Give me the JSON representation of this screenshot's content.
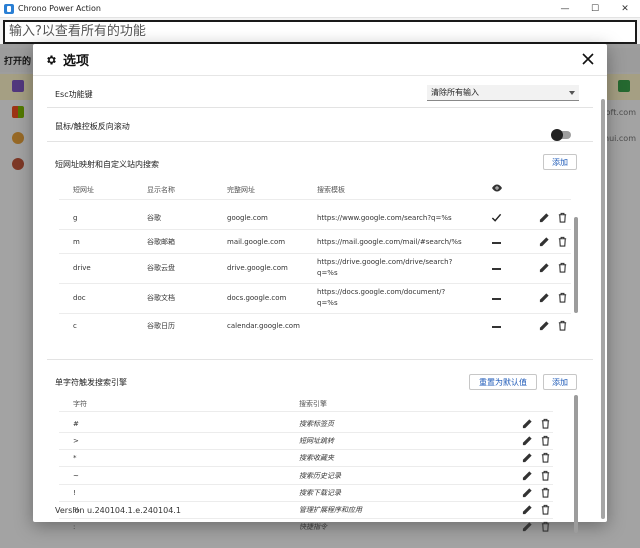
{
  "window": {
    "title": "Chrono Power Action",
    "controls": [
      "—",
      "☐",
      "✕"
    ]
  },
  "background": {
    "search_placeholder": "输入?以查看所有的功能",
    "open_label": "打开的",
    "row_hints": [
      "soft.com",
      "zhui.com"
    ]
  },
  "dialog": {
    "title": "选项",
    "esc": {
      "label": "Esc功能键",
      "selected": "清除所有输入"
    },
    "reverse_scroll": {
      "label": "鼠标/触控板反向滚动",
      "enabled": false
    },
    "shortcuts": {
      "section_title": "短网址映射和自定义站内搜索",
      "add_label": "添加",
      "headers": [
        "短网址",
        "显示名称",
        "完整网址",
        "搜索模板"
      ],
      "rows": [
        {
          "short": "g",
          "name": "谷歌",
          "url": "google.com",
          "template": "https://www.google.com/search?q=%s",
          "visible": true
        },
        {
          "short": "m",
          "name": "谷歌邮箱",
          "url": "mail.google.com",
          "template": "https://mail.google.com/mail/#search/%s",
          "visible": false
        },
        {
          "short": "drive",
          "name": "谷歌云盘",
          "url": "drive.google.com",
          "template": "https://drive.google.com/drive/search?q=%s",
          "template_line1": "https://drive.google.com/drive/search?",
          "template_line2": "q=%s",
          "visible": false
        },
        {
          "short": "doc",
          "name": "谷歌文档",
          "url": "docs.google.com",
          "template": "https://docs.google.com/document/?q=%s",
          "template_line1": "https://docs.google.com/document/?",
          "template_line2": "q=%s",
          "visible": false
        },
        {
          "short": "c",
          "name": "谷歌日历",
          "url": "calendar.google.com",
          "template": "",
          "visible": false
        }
      ]
    },
    "triggers": {
      "section_title": "单字符触发搜索引擎",
      "reset_label": "重置为默认值",
      "add_label": "添加",
      "headers": [
        "字符",
        "搜索引擎"
      ],
      "rows": [
        {
          "char": "#",
          "engine": "搜索标签页"
        },
        {
          "char": ">",
          "engine": "短网址跳转"
        },
        {
          "char": "*",
          "engine": "搜索收藏夹"
        },
        {
          "char": "~",
          "engine": "搜索历史记录"
        },
        {
          "char": "!",
          "engine": "搜索下载记录"
        },
        {
          "char": "%",
          "engine": "管理扩展程序和应用"
        },
        {
          "char": ":",
          "engine": "快捷指令"
        }
      ]
    },
    "version": "Version u.240104.1.e.240104.1"
  },
  "colors": {
    "accent": "#1e5ab8",
    "selected_row": "#fdf4c9"
  }
}
